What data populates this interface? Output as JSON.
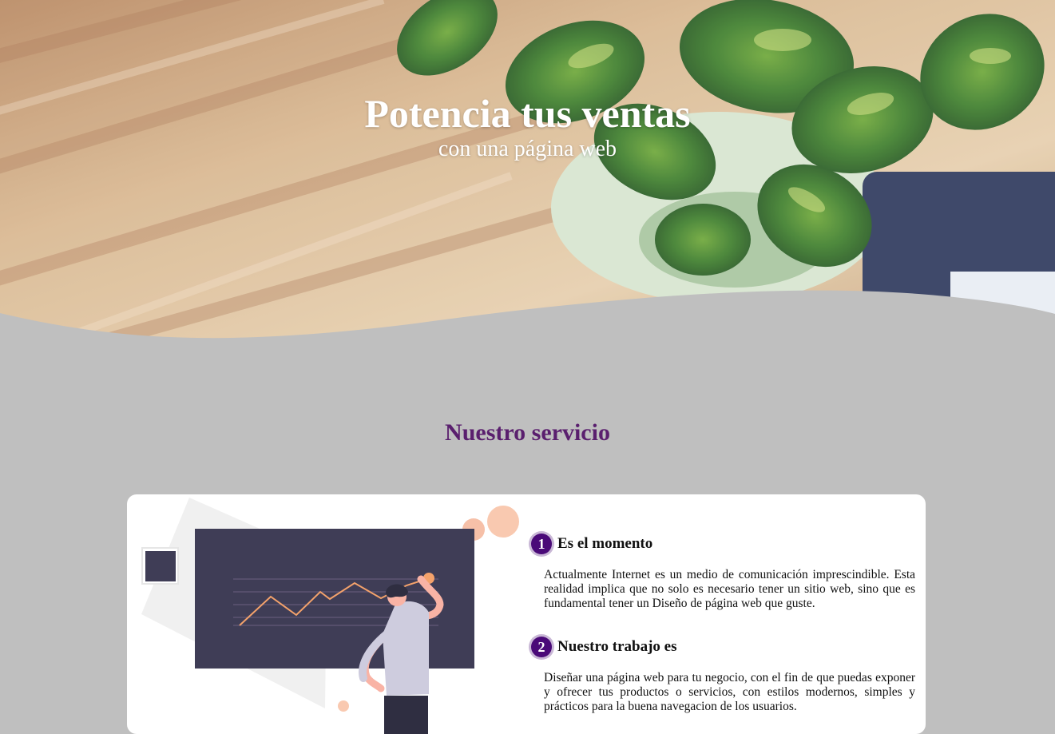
{
  "hero": {
    "title": "Potencia tus ventas",
    "subtitle": "con una página web"
  },
  "section": {
    "title": "Nuestro servicio"
  },
  "steps": [
    {
      "number": "1",
      "title": "Es el momento",
      "text": "Actualmente Internet es un medio de comunicación imprescindible. Esta realidad implica que no solo es necesario tener un sitio web, sino que es fundamental tener un Diseño de página web que guste."
    },
    {
      "number": "2",
      "title": "Nuestro trabajo es",
      "text": "Diseñar una página web para tu negocio, con el fin de que puedas exponer y ofrecer tus productos o servicios, con estilos modernos, simples y prácticos para la buena navegacion de los usuarios."
    }
  ],
  "colors": {
    "accent": "#4a0a78",
    "section_title": "#5a1f6e",
    "background": "#bfbfbf"
  }
}
